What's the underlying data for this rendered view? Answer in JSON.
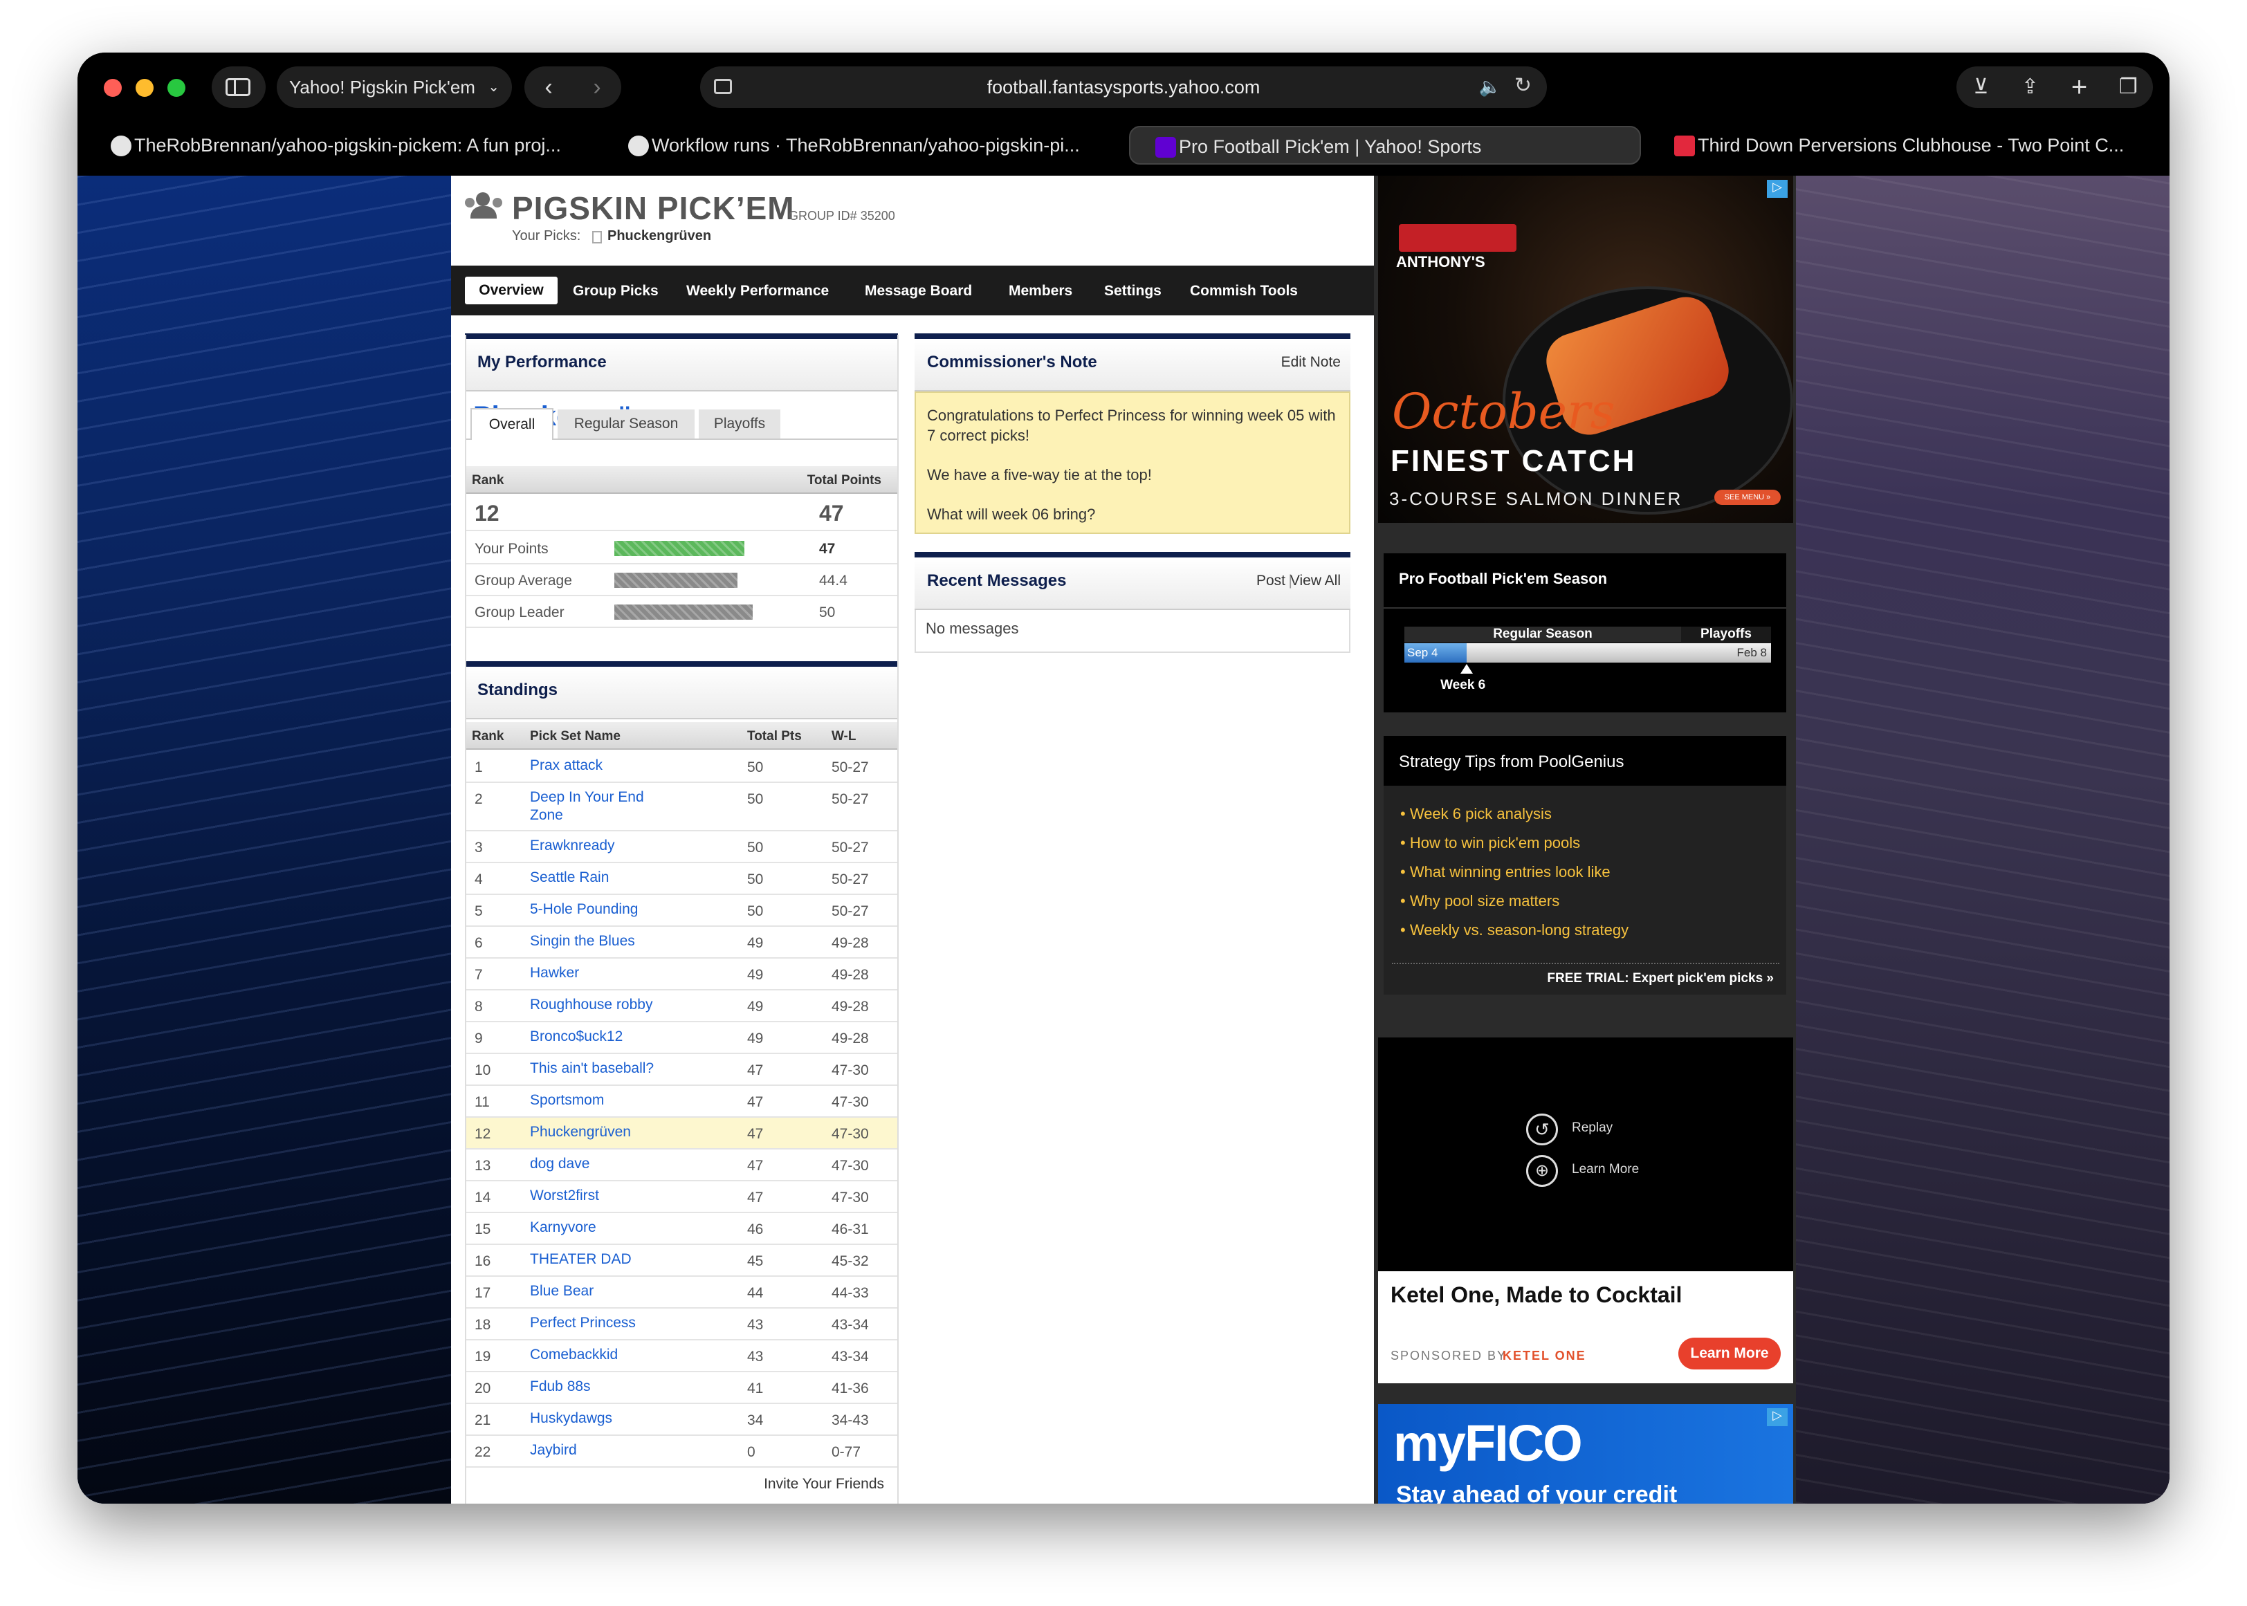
{
  "browser": {
    "tab_group_title": "Yahoo! Pigskin Pick'em",
    "url": "football.fantasysports.yahoo.com",
    "tabs": [
      {
        "label": "TheRobBrennan/yahoo-pigskin-pickem: A fun proj...",
        "icon": "github-icon"
      },
      {
        "label": "Workflow runs · TheRobBrennan/yahoo-pigskin-pi...",
        "icon": "github-icon"
      },
      {
        "label": "Pro Football Pick'em | Yahoo! Sports",
        "icon": "yahoo-icon",
        "active": true
      },
      {
        "label": "Third Down Perversions Clubhouse - Two Point C...",
        "icon": "bookmark-icon"
      }
    ]
  },
  "header": {
    "title": "PIGSKIN PICK’EM",
    "group_id": "GROUP ID# 35200",
    "your_picks_label": "Your Picks:",
    "your_picks_name": "Phuckengrüven"
  },
  "nav": [
    "Overview",
    "Group Picks",
    "Weekly Performance",
    "Message Board",
    "Members",
    "Settings",
    "Commish Tools"
  ],
  "performance": {
    "title": "My Performance",
    "team": "Phuckengrüven",
    "tabs": [
      "Overall",
      "Regular Season",
      "Playoffs"
    ],
    "rank_label": "Rank",
    "points_label": "Total Points",
    "rank": "12",
    "points": "47",
    "bars": [
      {
        "label": "Your Points",
        "value": "47",
        "fraction": 0.94,
        "color": "#5cb85c"
      },
      {
        "label": "Group Average",
        "value": "44.4",
        "fraction": 0.888,
        "color": "#8a8a8a"
      },
      {
        "label": "Group Leader",
        "value": "50",
        "fraction": 1.0,
        "color": "#8a8a8a"
      }
    ]
  },
  "standings": {
    "title": "Standings",
    "headers": [
      "Rank",
      "Pick Set Name",
      "Total Pts",
      "W-L"
    ],
    "rows": [
      [
        "1",
        "Prax attack",
        "50",
        "50-27"
      ],
      [
        "2",
        "Deep In Your End Zone",
        "50",
        "50-27"
      ],
      [
        "3",
        "Erawknready",
        "50",
        "50-27"
      ],
      [
        "4",
        "Seattle Rain",
        "50",
        "50-27"
      ],
      [
        "5",
        "5-Hole Pounding",
        "50",
        "50-27"
      ],
      [
        "6",
        "Singin the Blues",
        "49",
        "49-28"
      ],
      [
        "7",
        "Hawker",
        "49",
        "49-28"
      ],
      [
        "8",
        "Roughhouse robby",
        "49",
        "49-28"
      ],
      [
        "9",
        "Bronco$uck12",
        "49",
        "49-28"
      ],
      [
        "10",
        "This ain't baseball?",
        "47",
        "47-30"
      ],
      [
        "11",
        "Sportsmom",
        "47",
        "47-30"
      ],
      [
        "12",
        "Phuckengrüven",
        "47",
        "47-30"
      ],
      [
        "13",
        "dog dave",
        "47",
        "47-30"
      ],
      [
        "14",
        "Worst2first",
        "47",
        "47-30"
      ],
      [
        "15",
        "Karnyvore",
        "46",
        "46-31"
      ],
      [
        "16",
        "THEATER DAD",
        "45",
        "45-32"
      ],
      [
        "17",
        "Blue Bear",
        "44",
        "44-33"
      ],
      [
        "18",
        "Perfect Princess",
        "43",
        "43-34"
      ],
      [
        "19",
        "Comebackkid",
        "43",
        "43-34"
      ],
      [
        "20",
        "Fdub 88s",
        "41",
        "41-36"
      ],
      [
        "21",
        "Huskydawgs",
        "34",
        "34-43"
      ],
      [
        "22",
        "Jaybird",
        "0",
        "0-77"
      ]
    ],
    "highlight_rank": "12",
    "invite": "Invite Your Friends"
  },
  "commissioner": {
    "title": "Commissioner's Note",
    "edit": "Edit Note",
    "lines": [
      "Congratulations to Perfect Princess for winning week 05 with 7 correct picks!",
      "We have a five-way tie at the top!",
      "What will week 06 bring?"
    ]
  },
  "messages": {
    "title": "Recent Messages",
    "post": "Post",
    "view_all": "View All",
    "empty": "No messages"
  },
  "ad1": {
    "brand": "ANTHONY'S",
    "script": "Octobers",
    "headline": "FINEST CATCH",
    "sub": "3-COURSE SALMON DINNER",
    "cta": "SEE MENU »"
  },
  "season": {
    "title": "Pro Football Pick'em Season",
    "regular": "Regular Season",
    "playoffs": "Playoffs",
    "start": "Sep 4",
    "end": "Feb 8",
    "current": "Week 6",
    "progress": 0.17
  },
  "tips": {
    "title": "Strategy Tips from PoolGenius",
    "items": [
      "Week 6 pick analysis",
      "How to win pick'em pools",
      "What winning entries look like",
      "Why pool size matters",
      "Weekly vs. season-long strategy"
    ],
    "trial": "FREE TRIAL: Expert pick'em picks »"
  },
  "video_ad": {
    "replay": "Replay",
    "learn": "Learn More",
    "headline": "Ketel One, Made to Cocktail",
    "sponsored": "SPONSORED BY",
    "sponsor": "KETEL ONE",
    "cta": "Learn More"
  },
  "ad3": {
    "brand": "myFICO",
    "tag": "Stay ahead of your credit"
  }
}
